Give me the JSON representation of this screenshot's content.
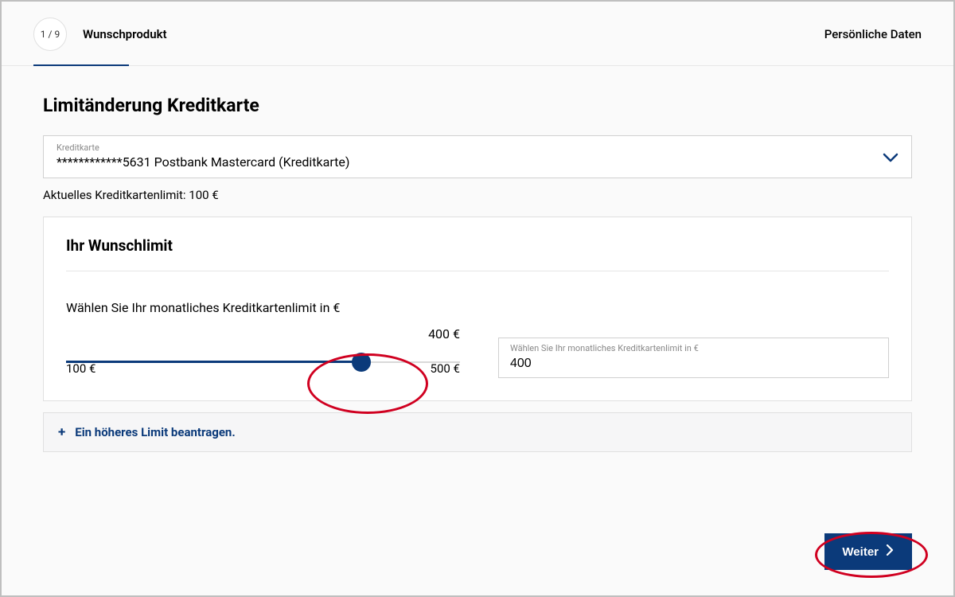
{
  "stepper": {
    "current_label": "1 / 9",
    "step_name": "Wunschprodukt",
    "next_step_name": "Persönliche Daten"
  },
  "page": {
    "title": "Limitänderung Kreditkarte"
  },
  "card_select": {
    "label": "Kreditkarte",
    "value": "************5631 Postbank Mastercard (Kreditkarte)"
  },
  "current_limit_text": "Aktuelles Kreditkartenlimit: 100 €",
  "panel": {
    "title": "Ihr Wunschlimit",
    "prompt": "Wählen Sie Ihr monatliches Kreditkartenlimit in €"
  },
  "slider": {
    "min_label": "100 €",
    "max_label": "500 €",
    "value_label": "400 €",
    "min": 100,
    "max": 500,
    "value": 400
  },
  "limit_input": {
    "label": "Wählen Sie Ihr monatliches Kreditkartenlimit in €",
    "value": "400"
  },
  "expander": {
    "plus": "+",
    "text": "Ein höheres Limit beantragen."
  },
  "buttons": {
    "next": "Weiter"
  }
}
